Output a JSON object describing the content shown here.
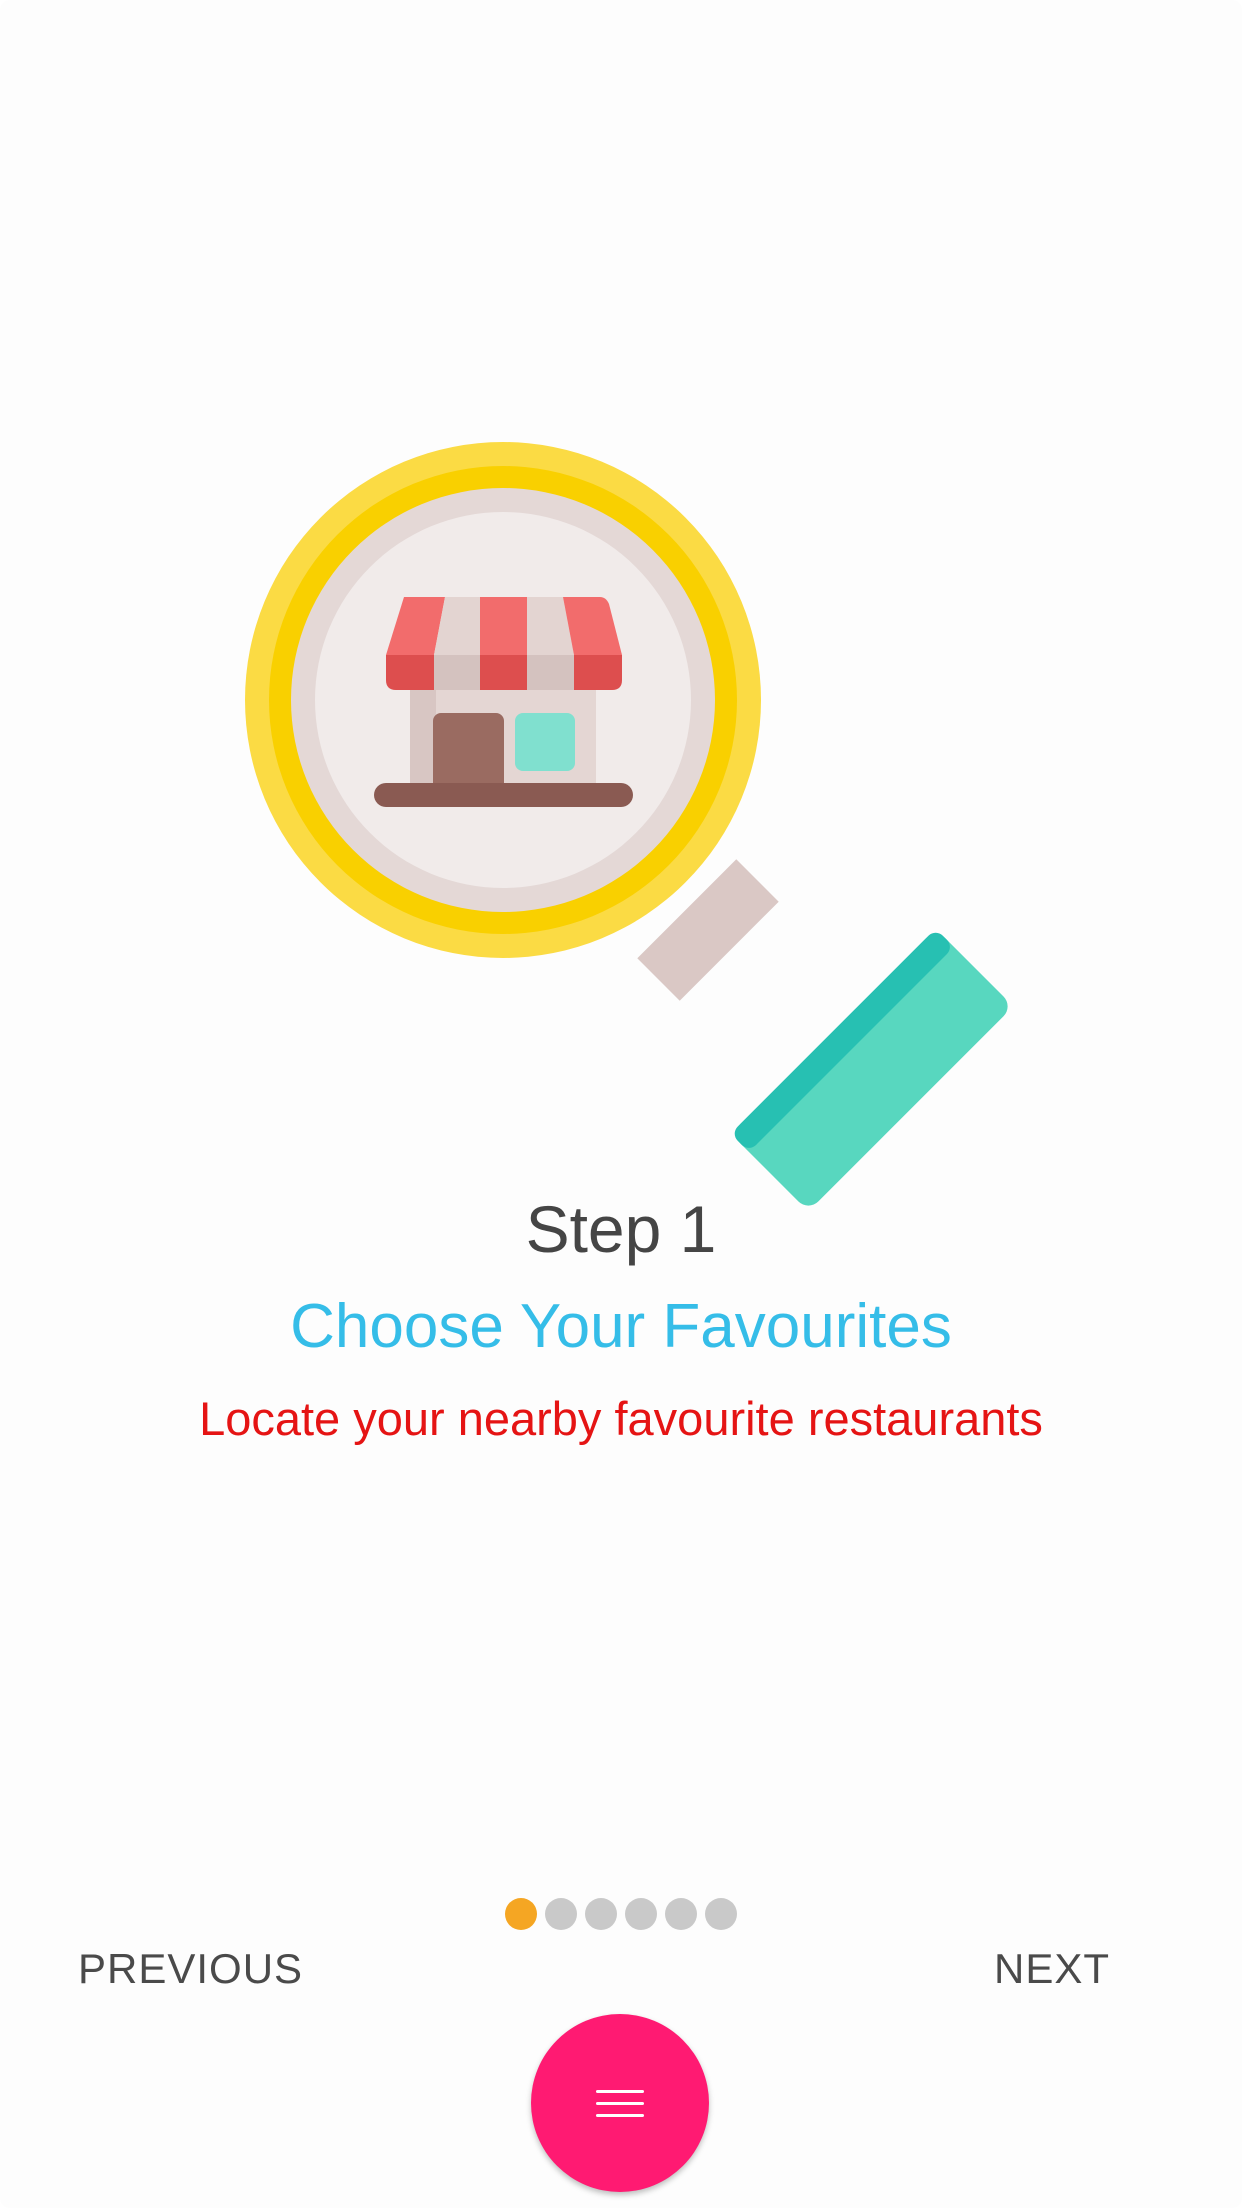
{
  "onboarding": {
    "step_label": "Step 1",
    "title": "Choose Your Favourites",
    "description": "Locate your nearby favourite restaurants",
    "illustration_icon": "magnifier-store-icon"
  },
  "pagination": {
    "total": 6,
    "current": 1
  },
  "navigation": {
    "previous_label": "PREVIOUS",
    "next_label": "NEXT"
  },
  "fab": {
    "icon": "menu-icon"
  },
  "colors": {
    "step_text": "#454545",
    "title_text": "#35bde8",
    "description_text": "#e51414",
    "active_dot": "#f5a623",
    "inactive_dot": "#c9c9c9",
    "fab_background": "#ff1a72"
  }
}
